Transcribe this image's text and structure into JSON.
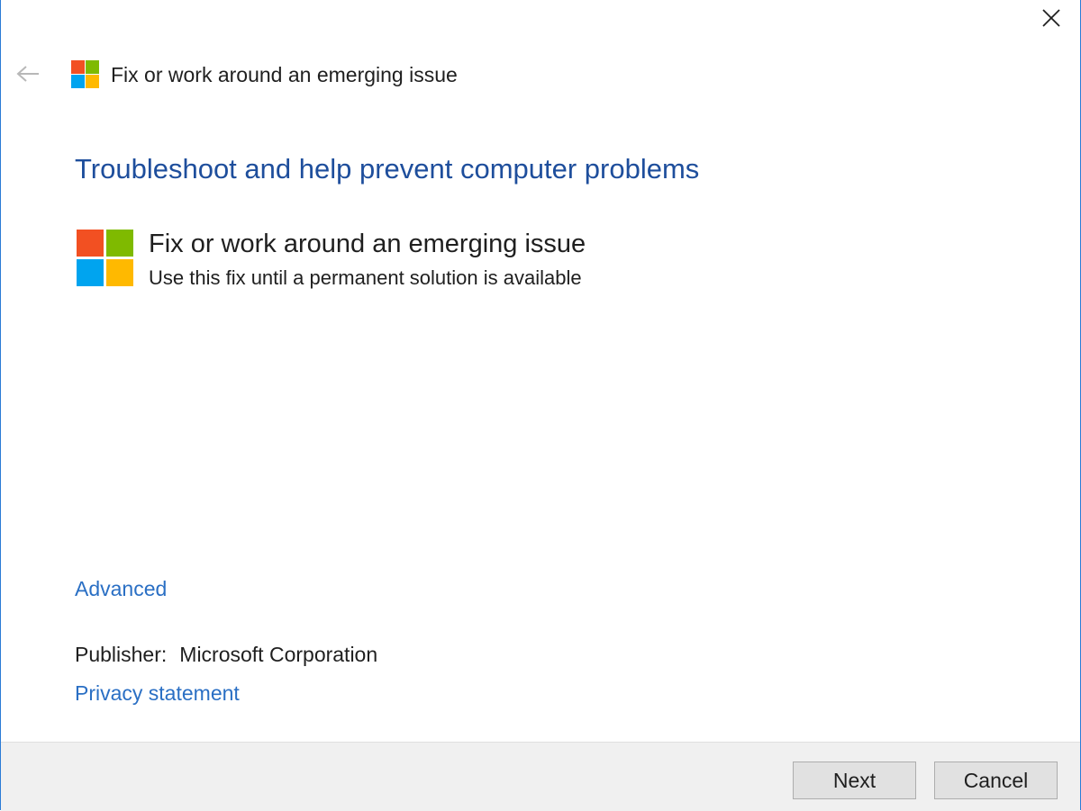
{
  "window": {
    "title": "Fix or work around an emerging issue"
  },
  "main": {
    "heading": "Troubleshoot and help prevent computer problems",
    "item": {
      "title": "Fix or work around an emerging issue",
      "description": "Use this fix until a permanent solution is available",
      "icon": "microsoft-logo-icon"
    },
    "advanced_label": "Advanced",
    "publisher_label": "Publisher:",
    "publisher_value": "Microsoft Corporation",
    "privacy_label": "Privacy statement"
  },
  "footer": {
    "next_label": "Next",
    "cancel_label": "Cancel"
  },
  "icons": {
    "close": "close-icon",
    "back": "back-arrow-icon",
    "logo": "microsoft-logo-icon"
  },
  "colors": {
    "heading": "#1e4e9c",
    "link": "#2a6fc4",
    "logo_red": "#f25022",
    "logo_green": "#7fba00",
    "logo_blue": "#00a4ef",
    "logo_yellow": "#ffb900"
  }
}
